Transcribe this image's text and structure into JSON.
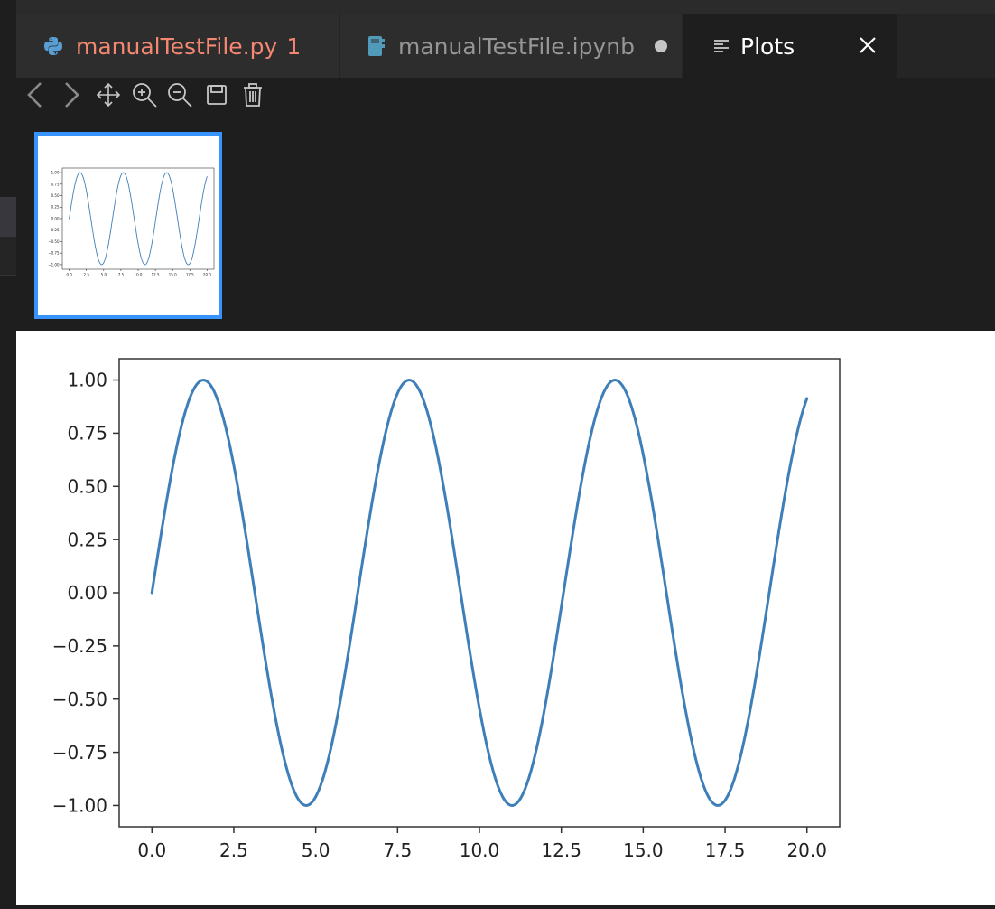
{
  "tabs": [
    {
      "label": "manualTestFile.py",
      "badge": "1",
      "icon": "python-icon"
    },
    {
      "label": "manualTestFile.ipynb",
      "icon": "notebook-icon"
    },
    {
      "label": "Plots",
      "icon": "list-icon"
    }
  ],
  "toolbar": [
    "chevron-left-icon",
    "chevron-right-icon",
    "move-icon",
    "zoom-in-icon",
    "zoom-out-icon",
    "save-icon",
    "trash-icon"
  ],
  "colors": {
    "accent": "#3794ff",
    "error_tab": "#f48771",
    "series": "#3e7fb9"
  },
  "chart_data": {
    "type": "line",
    "function": "sin(x)",
    "x_range": [
      0,
      20
    ],
    "xlim": [
      -1.0,
      21.0
    ],
    "ylim": [
      -1.1,
      1.1
    ],
    "xticks": [
      "0.0",
      "2.5",
      "5.0",
      "7.5",
      "10.0",
      "12.5",
      "15.0",
      "17.5",
      "20.0"
    ],
    "yticks": [
      "1.00",
      "0.75",
      "0.50",
      "0.25",
      "0.00",
      "−0.25",
      "−0.50",
      "−0.75",
      "−1.00"
    ],
    "x": [
      0,
      1,
      2,
      3,
      4,
      5,
      6,
      7,
      8,
      9,
      10,
      11,
      12,
      13,
      14,
      15,
      16,
      17,
      18,
      19,
      20
    ],
    "y": [
      0.0,
      0.841,
      0.909,
      0.141,
      -0.757,
      -0.959,
      -0.279,
      0.657,
      0.989,
      0.412,
      -0.544,
      -1.0,
      -0.537,
      0.42,
      0.991,
      0.65,
      -0.288,
      -0.961,
      -0.751,
      0.15,
      0.913
    ],
    "grid": false,
    "title": "",
    "xlabel": "",
    "ylabel": ""
  }
}
